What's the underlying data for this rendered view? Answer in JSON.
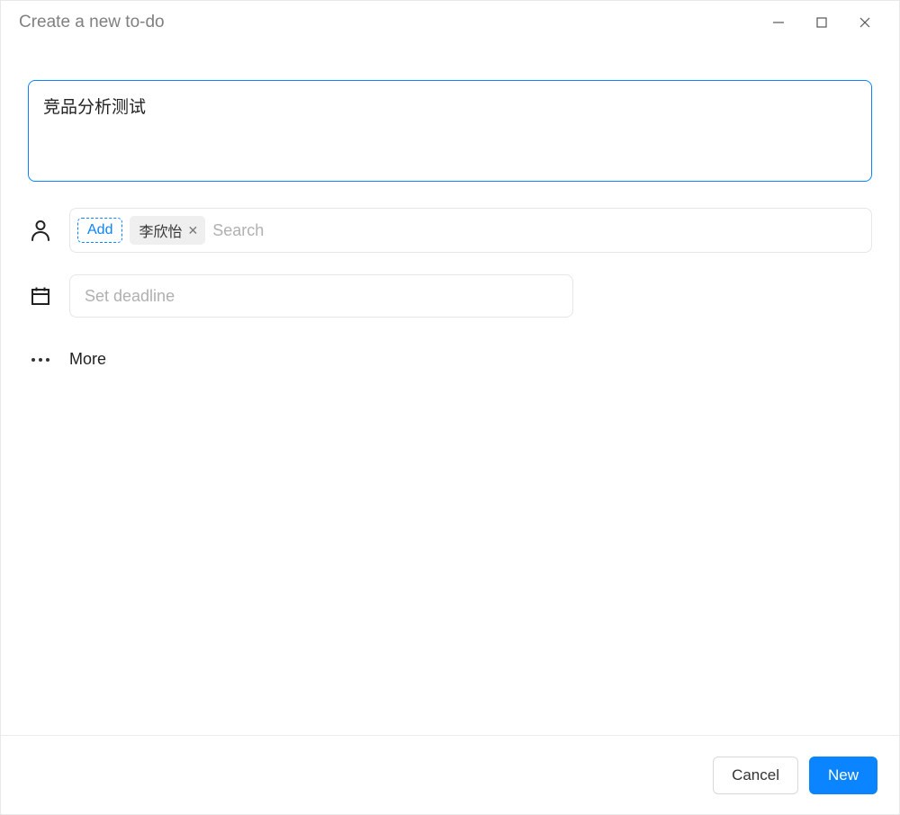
{
  "window": {
    "title": "Create a new to-do"
  },
  "form": {
    "title_value": "竞品分析测试",
    "assignee": {
      "add_label": "Add",
      "chips": [
        "李欣怡"
      ],
      "search_placeholder": "Search"
    },
    "deadline": {
      "placeholder": "Set deadline",
      "value": ""
    },
    "more_label": "More"
  },
  "footer": {
    "cancel_label": "Cancel",
    "new_label": "New"
  }
}
